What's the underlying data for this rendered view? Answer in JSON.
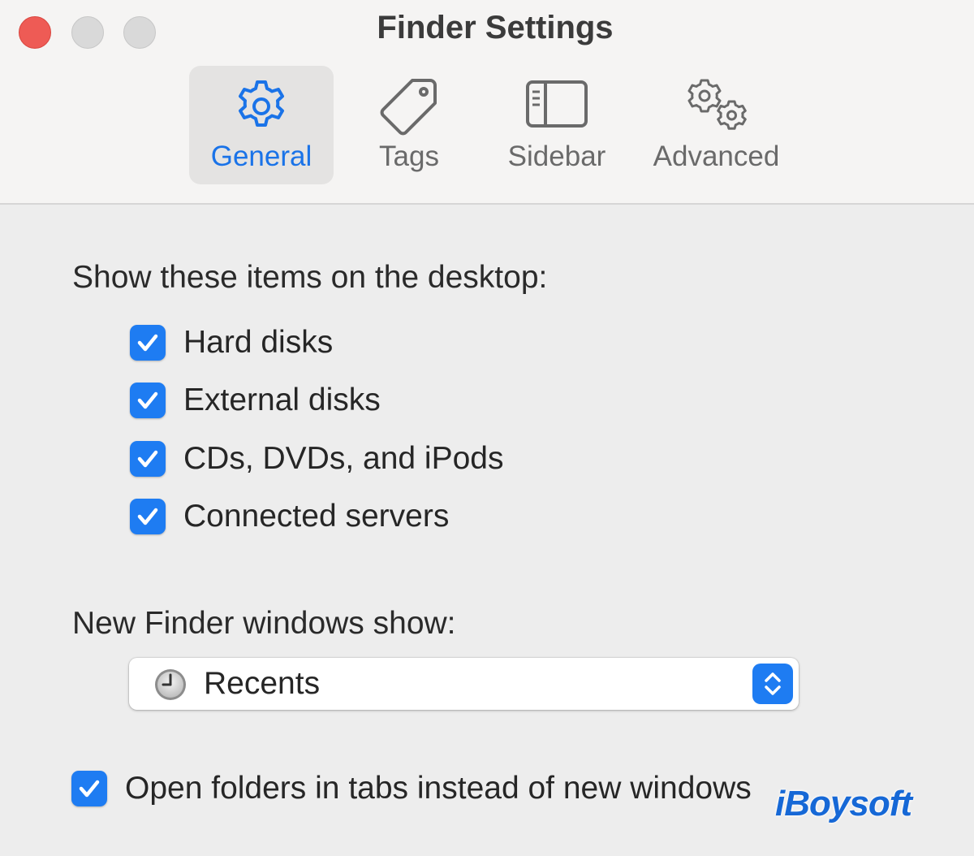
{
  "window": {
    "title": "Finder Settings"
  },
  "tabs": [
    {
      "label": "General",
      "icon": "gear-icon",
      "selected": true
    },
    {
      "label": "Tags",
      "icon": "tag-icon",
      "selected": false
    },
    {
      "label": "Sidebar",
      "icon": "sidebar-icon",
      "selected": false
    },
    {
      "label": "Advanced",
      "icon": "gears-icon",
      "selected": false
    }
  ],
  "desktop": {
    "heading": "Show these items on the desktop:",
    "items": [
      {
        "label": "Hard disks",
        "checked": true
      },
      {
        "label": "External disks",
        "checked": true
      },
      {
        "label": "CDs, DVDs, and iPods",
        "checked": true
      },
      {
        "label": "Connected servers",
        "checked": true
      }
    ]
  },
  "new_windows": {
    "heading": "New Finder windows show:",
    "selected_value": "Recents",
    "icon": "clock-icon"
  },
  "tabs_option": {
    "label": "Open folders in tabs instead of new windows",
    "checked": true
  },
  "watermark": {
    "text": "iBoysoft"
  },
  "colors": {
    "accent": "#1e7cf2",
    "close_button": "#ee5b55",
    "watermark": "#1668d6"
  }
}
